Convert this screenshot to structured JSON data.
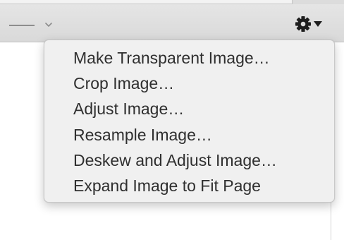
{
  "toolbar": {
    "line_style_icon": "line-style-icon",
    "line_style_chevron_icon": "chevron-down-icon",
    "action_menu_icon": "gear-icon",
    "action_menu_caret_icon": "caret-down-icon"
  },
  "menu": {
    "items": [
      {
        "label": "Make Transparent Image…"
      },
      {
        "label": "Crop Image…"
      },
      {
        "label": "Adjust Image…"
      },
      {
        "label": "Resample Image…"
      },
      {
        "label": "Deskew and Adjust Image…"
      },
      {
        "label": "Expand Image to Fit Page"
      }
    ]
  },
  "colors": {
    "toolbar_bg": "#dedede",
    "menu_bg": "#f0f0f0",
    "menu_text": "#2f2f2f",
    "icon": "#1e1e1e"
  }
}
